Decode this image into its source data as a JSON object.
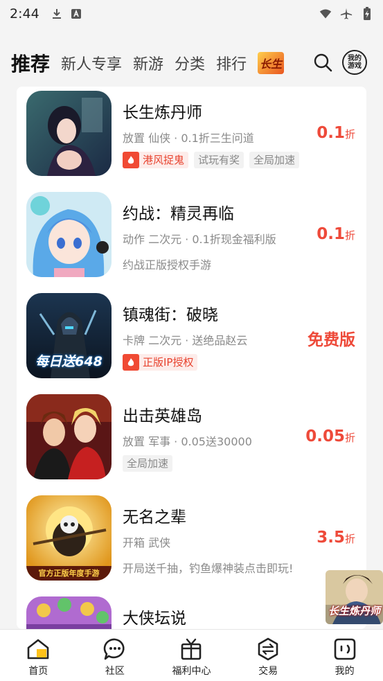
{
  "status_bar": {
    "time": "2:44"
  },
  "top_nav": {
    "tabs": [
      "推荐",
      "新人专享",
      "新游",
      "分类",
      "排行"
    ],
    "active_index": 0,
    "promo_logo_text": "长生",
    "my_games_label_1": "我的",
    "my_games_label_2": "游戏"
  },
  "games": [
    {
      "title": "长生炼丹师",
      "meta": "放置 仙侠 · 0.1折三生问道",
      "price": "0.1",
      "price_unit": "折",
      "highlight_tag": "港风捉鬼",
      "tags": [
        "试玩有奖",
        "全局加速"
      ],
      "desc": ""
    },
    {
      "title": "约战：精灵再临",
      "meta": "动作 二次元 · 0.1折现金福利版",
      "price": "0.1",
      "price_unit": "折",
      "highlight_tag": "",
      "tags": [],
      "desc": "约战正版授权手游"
    },
    {
      "title": "镇魂街：破晓",
      "meta": "卡牌 二次元 · 送绝品赵云",
      "price": "免费版",
      "price_unit": "",
      "highlight_tag": "正版IP授权",
      "tags": [],
      "desc": ""
    },
    {
      "title": "出击英雄岛",
      "meta": "放置 军事 · 0.05送30000",
      "price": "0.05",
      "price_unit": "折",
      "highlight_tag": "",
      "tags": [
        "全局加速"
      ],
      "desc": ""
    },
    {
      "title": "无名之辈",
      "meta": "开箱 武侠",
      "price": "3.5",
      "price_unit": "折",
      "highlight_tag": "",
      "tags": [],
      "desc": "开局送千抽，钓鱼爆神装点击即玩!"
    },
    {
      "title": "大侠坛说",
      "meta": "",
      "price": "",
      "price_unit": "",
      "highlight_tag": "",
      "tags": [],
      "desc": ""
    }
  ],
  "game_image_text": {
    "game3_overlay": "每日送648",
    "game5_overlay": "官方正版年度手游"
  },
  "float_ad_text": "长生炼丹师",
  "bottom_nav": [
    {
      "label": "首页",
      "icon": "home-icon",
      "active": true
    },
    {
      "label": "社区",
      "icon": "community-chat-icon",
      "active": false
    },
    {
      "label": "福利中心",
      "icon": "gift-icon",
      "active": false
    },
    {
      "label": "交易",
      "icon": "exchange-icon",
      "active": false
    },
    {
      "label": "我的",
      "icon": "profile-icon",
      "active": false
    }
  ],
  "colors": {
    "price_red": "#ee4a3a",
    "accent_yellow": "#ffc21a"
  }
}
